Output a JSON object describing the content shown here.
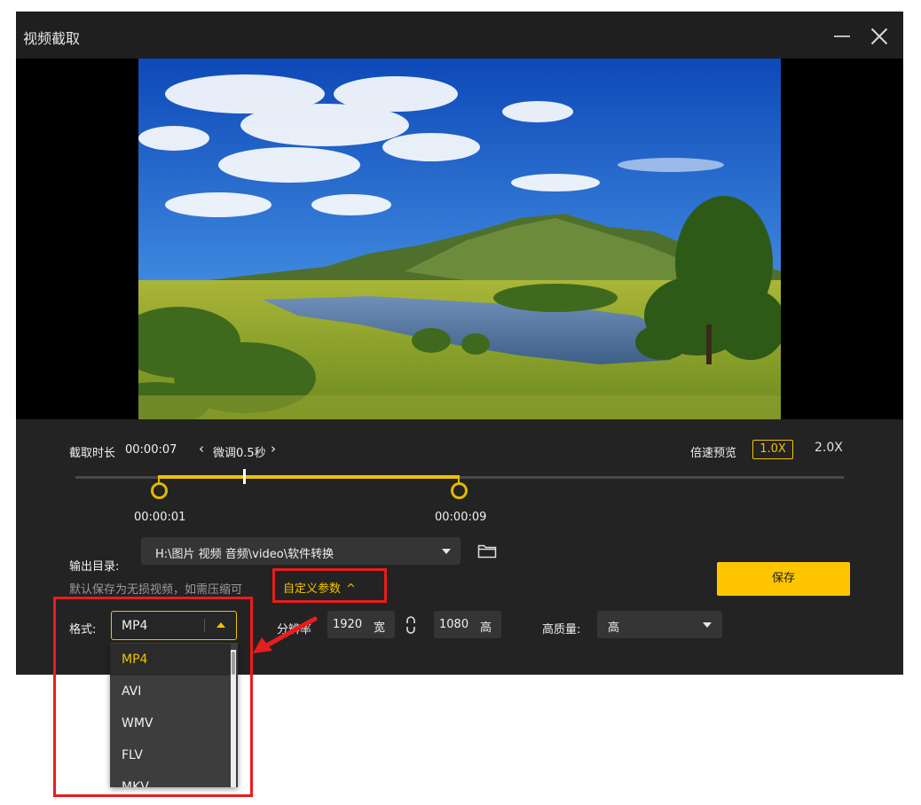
{
  "window": {
    "title": "视频截取"
  },
  "trim": {
    "duration_label": "截取时长",
    "duration_value": "00:00:07",
    "fine_tune_label": "微调0.5秒",
    "prev_glyph": "‹",
    "next_glyph": "›",
    "start_time": "00:00:01",
    "end_time": "00:00:09"
  },
  "speed": {
    "label": "倍速预览",
    "options": [
      "1.0X",
      "2.0X"
    ],
    "selected": "1.0X"
  },
  "output": {
    "label": "输出目录:",
    "path": "H:\\图片 视频 音频\\video\\软件转换",
    "hint": "默认保存为无损视频，如需压缩可",
    "custom_params": "自定义参数",
    "save_label": "保存"
  },
  "format": {
    "label": "格式:",
    "selected": "MP4",
    "options": [
      "MP4",
      "AVI",
      "WMV",
      "FLV",
      "MKV"
    ]
  },
  "resolution": {
    "label": "分辨率",
    "width": "1920",
    "width_unit": "宽",
    "height": "1080",
    "height_unit": "高"
  },
  "quality": {
    "label": "高质量:",
    "selected": "高"
  },
  "colors": {
    "accent": "#f2c200",
    "save_button": "#ffc600",
    "annotation": "#ea1c1c",
    "panel": "#232323"
  },
  "icons": {
    "folder": "folder-icon",
    "link": "link-icon",
    "minimize": "minimize-icon",
    "close": "close-icon"
  }
}
